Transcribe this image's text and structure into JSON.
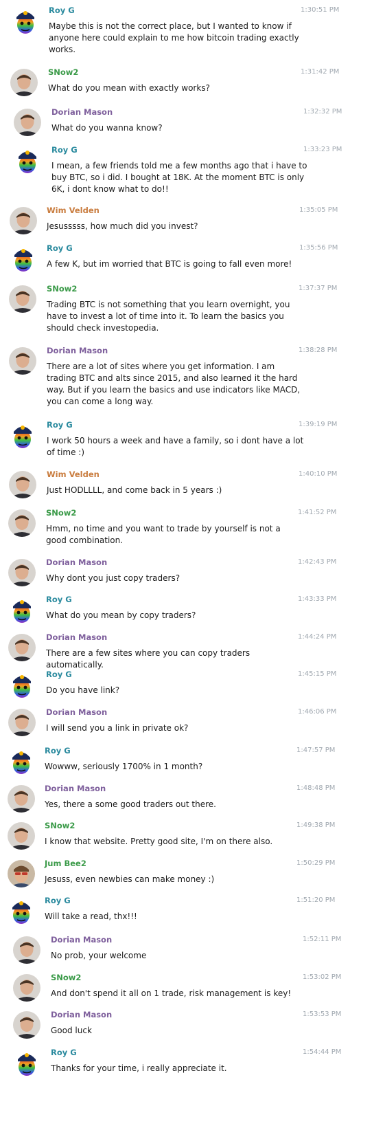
{
  "users": {
    "roy": {
      "name": "Roy G",
      "color": "#2a8a9e",
      "avatar": "rainbow-face-helmet"
    },
    "snow": {
      "name": "SNow2",
      "color": "#3a9a48",
      "avatar": "man-portrait"
    },
    "dorian": {
      "name": "Dorian Mason",
      "color": "#7e5f9c",
      "avatar": "man-portrait"
    },
    "wim": {
      "name": "Wim Velden",
      "color": "#c97c3e",
      "avatar": "man-portrait"
    },
    "jum": {
      "name": "Jum Bee2",
      "color": "#3a9a48",
      "avatar": "man-sunglasses-portrait"
    }
  },
  "messages": [
    {
      "user": "roy",
      "name": "Roy G",
      "time": "1:30:51 PM",
      "text": "Maybe this is not the correct place, but I wanted to know if anyone here could explain to me how bitcoin trading exactly works."
    },
    {
      "user": "snow",
      "name": "SNow2",
      "time": "1:31:42 PM",
      "text": "What do you mean with exactly works?"
    },
    {
      "user": "dorian",
      "name": "Dorian Mason",
      "time": "1:32:32 PM",
      "text": "What do you wanna know?"
    },
    {
      "user": "roy",
      "name": "Roy G",
      "time": "1:33:23 PM",
      "text": "I mean, a few friends told me a few months ago that i have to buy BTC, so i did. I bought at 18K. At the moment BTC is only 6K, i dont know what to do!!"
    },
    {
      "user": "wim",
      "name": "Wim Velden",
      "time": "1:35:05 PM",
      "text": "Jesusssss, how much did you invest?"
    },
    {
      "user": "roy",
      "name": "Roy G",
      "time": "1:35:56 PM",
      "text": "A few K, but im worried that BTC is going to fall even more!"
    },
    {
      "user": "snow",
      "name": "SNow2",
      "time": "1:37:37 PM",
      "text": "Trading BTC is not something that you learn overnight, you have to invest a lot of time into it. To learn the basics you should check investopedia."
    },
    {
      "user": "dorian",
      "name": "Dorian Mason",
      "time": "1:38:28 PM",
      "text": "There are a lot of sites where you get information. I am trading BTC and alts since 2015, and also learned it the hard way. But if you learn the basics and use indicators like MACD, you can come a long way."
    },
    {
      "user": "roy",
      "name": "Roy G",
      "time": "1:39:19 PM",
      "text": "I work 50 hours a week and have a family, so i dont have a lot of time :)"
    },
    {
      "user": "wim",
      "name": "Wim Velden",
      "time": "1:40:10 PM",
      "text": "Just HODLLLL, and come back in 5 years :)"
    },
    {
      "user": "snow",
      "name": "SNow2",
      "time": "1:41:52 PM",
      "text": "Hmm, no time and you want to trade by yourself is not a good combination."
    },
    {
      "user": "dorian",
      "name": "Dorian Mason",
      "time": "1:42:43 PM",
      "text": "Why dont you just copy traders?"
    },
    {
      "user": "roy",
      "name": "Roy G",
      "time": "1:43:33 PM",
      "text": "What do you mean by copy traders?"
    },
    {
      "user": "dorian",
      "name": "Dorian Mason",
      "time": "1:44:24 PM",
      "text": "There are a few sites where you can copy traders automatically."
    },
    {
      "user": "roy",
      "name": "Roy G",
      "time": "1:45:15 PM",
      "text": "Do you have link?"
    },
    {
      "user": "dorian",
      "name": "Dorian Mason",
      "time": "1:46:06 PM",
      "text": "I will send you a link in private ok?"
    },
    {
      "user": "roy",
      "name": "Roy G",
      "time": "1:47:57 PM",
      "text": "Wowww, seriously 1700% in 1 month?"
    },
    {
      "user": "dorian",
      "name": "Dorian Mason",
      "time": "1:48:48 PM",
      "text": "Yes, there a some good traders out there."
    },
    {
      "user": "snow",
      "name": "SNow2",
      "time": "1:49:38 PM",
      "text": "I know that website. Pretty good site, I'm on there also."
    },
    {
      "user": "jum",
      "name": "Jum Bee2",
      "time": "1:50:29 PM",
      "text": "Jesuss, even newbies can make money :)"
    },
    {
      "user": "roy",
      "name": "Roy G",
      "time": "1:51:20 PM",
      "text": "Will take a read, thx!!!"
    },
    {
      "user": "dorian",
      "name": "Dorian Mason",
      "time": "1:52:11 PM",
      "text": "No prob, your welcome"
    },
    {
      "user": "snow",
      "name": "SNow2",
      "time": "1:53:02 PM",
      "text": "And don't spend it all on 1 trade, risk management is key!"
    },
    {
      "user": "dorian",
      "name": "Dorian Mason",
      "time": "1:53:53 PM",
      "text": "Good luck"
    },
    {
      "user": "roy",
      "name": "Roy G",
      "time": "1:54:44 PM",
      "text": "Thanks for your time, i really appreciate it."
    }
  ]
}
